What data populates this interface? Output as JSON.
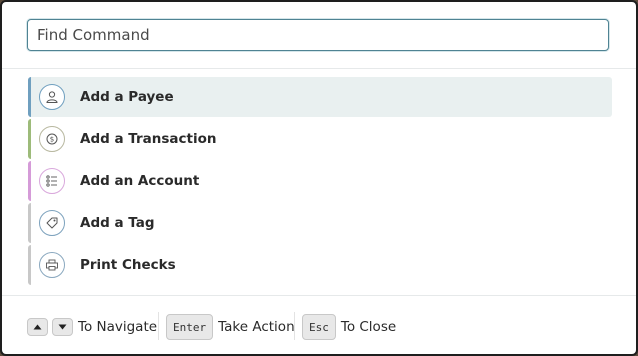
{
  "search": {
    "placeholder": "Find Command"
  },
  "commands": [
    {
      "label": "Add a Payee",
      "icon": "person-icon",
      "accent": "#6f9fbf",
      "ring": "#6f9fbf",
      "selected": true
    },
    {
      "label": "Add a Transaction",
      "icon": "money-icon",
      "accent": "#9dbb7a",
      "ring": "#b8b8a0",
      "selected": false
    },
    {
      "label": "Add an Account",
      "icon": "list-icon",
      "accent": "#d59bd8",
      "ring": "#d9a8dc",
      "selected": false
    },
    {
      "label": "Add a Tag",
      "icon": "tag-icon",
      "accent": "#c8c8c8",
      "ring": "#7da2bd",
      "selected": false
    },
    {
      "label": "Print Checks",
      "icon": "printer-icon",
      "accent": "#c8c8c8",
      "ring": "#8aa8bf",
      "selected": false
    }
  ],
  "footer": {
    "navigate_label": "To Navigate",
    "enter_key": "Enter",
    "action_label": "Take Action",
    "esc_key": "Esc",
    "close_label": "To Close"
  }
}
